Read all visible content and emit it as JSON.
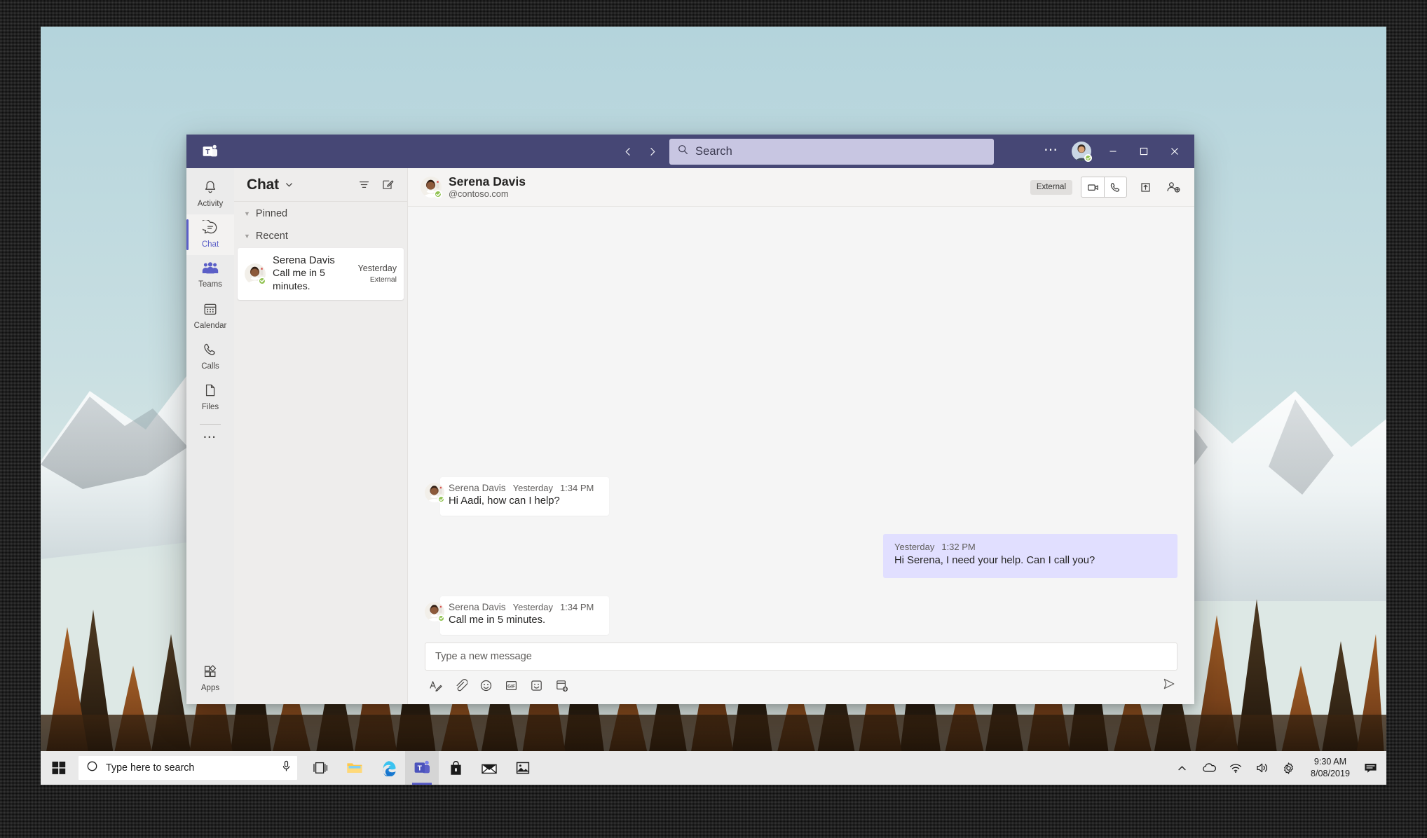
{
  "window": {
    "app_name": "Microsoft Teams",
    "logo_icon": "teams-logo-icon",
    "nav_back_icon": "chevron-left-icon",
    "nav_forward_icon": "chevron-right-icon",
    "more_icon": "ellipsis-icon",
    "minimize_icon": "minimize-icon",
    "maximize_icon": "maximize-icon",
    "close_icon": "close-icon"
  },
  "search": {
    "placeholder": "Search",
    "value": "",
    "icon": "search-icon"
  },
  "rail": {
    "items": [
      {
        "label": "Activity",
        "icon": "bell-icon",
        "active": false
      },
      {
        "label": "Chat",
        "icon": "chat-bubble-icon",
        "active": true
      },
      {
        "label": "Teams",
        "icon": "people-icon",
        "active": false
      },
      {
        "label": "Calendar",
        "icon": "calendar-icon",
        "active": false
      },
      {
        "label": "Calls",
        "icon": "phone-icon",
        "active": false
      },
      {
        "label": "Files",
        "icon": "file-icon",
        "active": false
      }
    ],
    "more_label": "...",
    "more_icon": "ellipsis-icon",
    "apps": {
      "label": "Apps",
      "icon": "apps-grid-icon"
    }
  },
  "chat_list": {
    "title": "Chat",
    "title_chevron_icon": "chevron-down-icon",
    "filter_icon": "filter-icon",
    "new_chat_icon": "compose-new-chat-icon",
    "groups": [
      {
        "label": "Pinned",
        "collapse_icon": "triangle-down-icon",
        "items": []
      },
      {
        "label": "Recent",
        "collapse_icon": "triangle-down-icon",
        "items": [
          {
            "name": "Serena Davis",
            "preview": "Call me in 5 minutes.",
            "time": "Yesterday",
            "tag": "External",
            "presence": "available",
            "selected": true
          }
        ]
      }
    ]
  },
  "conversation": {
    "title": "Serena Davis",
    "subtitle": "@contoso.com",
    "presence": "available",
    "external_badge": "External",
    "actions": {
      "video_call_icon": "video-camera-icon",
      "audio_call_icon": "phone-icon",
      "share_screen_icon": "share-upload-icon",
      "add_people_icon": "add-person-icon"
    },
    "messages": [
      {
        "direction": "incoming",
        "sender": "Serena Davis",
        "day": "Yesterday",
        "time": "1:34 PM",
        "text": "Hi Aadi, how can I help?",
        "presence": "available"
      },
      {
        "direction": "outgoing",
        "sender": "",
        "day": "Yesterday",
        "time": "1:32 PM",
        "text": "Hi Serena, I need your help. Can I call you?"
      },
      {
        "direction": "incoming",
        "sender": "Serena Davis",
        "day": "Yesterday",
        "time": "1:34 PM",
        "text": "Call me in 5 minutes.",
        "presence": "available"
      }
    ]
  },
  "compose": {
    "placeholder": "Type a new message",
    "value": "",
    "tools": [
      {
        "name": "format-text-icon",
        "label": "Format"
      },
      {
        "name": "attach-file-icon",
        "label": "Attach"
      },
      {
        "name": "emoji-icon",
        "label": "Emoji"
      },
      {
        "name": "gif-icon",
        "label": "GIF"
      },
      {
        "name": "sticker-icon",
        "label": "Sticker"
      },
      {
        "name": "add-extension-icon",
        "label": "More apps"
      }
    ],
    "send_icon": "send-icon"
  },
  "taskbar": {
    "start_icon": "windows-start-icon",
    "search": {
      "placeholder": "Type here to search",
      "circle_icon": "cortana-circle-icon",
      "mic_icon": "microphone-icon"
    },
    "pinned": [
      {
        "name": "task-view-icon",
        "label": "Task View",
        "active": false
      },
      {
        "name": "file-explorer-icon",
        "label": "File Explorer",
        "active": false
      },
      {
        "name": "edge-icon",
        "label": "Microsoft Edge",
        "active": false
      },
      {
        "name": "teams-taskbar-icon",
        "label": "Microsoft Teams",
        "active": true
      },
      {
        "name": "store-icon",
        "label": "Microsoft Store",
        "active": false
      },
      {
        "name": "mail-icon",
        "label": "Mail",
        "active": false
      },
      {
        "name": "photos-icon",
        "label": "Photos",
        "active": false
      }
    ],
    "tray": [
      {
        "name": "show-hidden-icons-icon",
        "label": "Show hidden icons"
      },
      {
        "name": "onedrive-cloud-icon",
        "label": "OneDrive"
      },
      {
        "name": "wifi-icon",
        "label": "Network"
      },
      {
        "name": "volume-icon",
        "label": "Volume"
      },
      {
        "name": "settings-gear-icon",
        "label": "Settings"
      }
    ],
    "clock": {
      "time": "9:30 AM",
      "date": "8/08/2019"
    },
    "notifications_icon": "notification-center-icon"
  },
  "colors": {
    "teams_purple": "#464775",
    "accent": "#5b5fc7",
    "presence_green": "#92c353",
    "outgoing_bubble": "#e1dfff",
    "search_field": "#c8c6e2"
  }
}
